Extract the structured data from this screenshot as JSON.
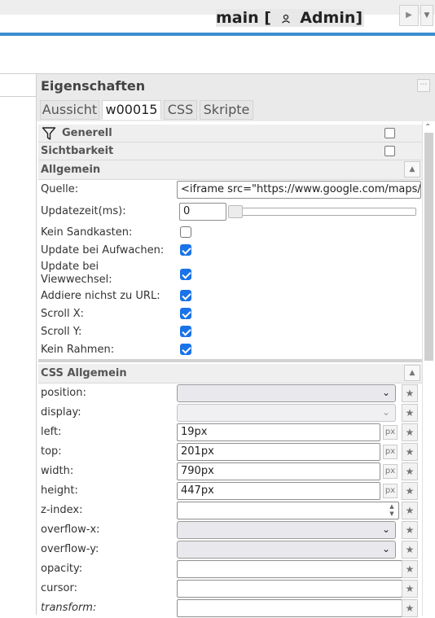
{
  "topbar": {
    "view_name": "main [",
    "user_name": "Admin]",
    "play_icon": "play-icon",
    "menu_icon": "dropdown-arrow-icon"
  },
  "panel": {
    "title": "Eigenschaften",
    "tabs": [
      "Aussicht",
      "w00015",
      "CSS",
      "Skripte"
    ],
    "active_tab": "w00015"
  },
  "groups": {
    "generell": "Generell",
    "sichtbarkeit": "Sichtbarkeit",
    "allgemein": "Allgemein",
    "css_allgemein": "CSS Allgemein"
  },
  "allgemein": {
    "quelle_label": "Quelle:",
    "quelle_value": "<iframe src=\"https://www.google.com/maps/",
    "update_label": "Updatezeit(ms):",
    "update_value": "0",
    "update_slider_level": 0,
    "kein_sandkasten": {
      "label": "Kein Sandkasten:",
      "checked": false
    },
    "update_aufwachen": {
      "label": "Update bei Aufwachen:",
      "checked": true
    },
    "update_viewwechsel": {
      "label": "Update bei Viewwechsel:",
      "checked": true
    },
    "addiere": {
      "label": "Addiere nichst zu URL:",
      "checked": true
    },
    "scroll_x": {
      "label": "Scroll X:",
      "checked": true
    },
    "scroll_y": {
      "label": "Scroll Y:",
      "checked": true
    },
    "kein_rahmen": {
      "label": "Kein Rahmen:",
      "checked": true
    }
  },
  "css": {
    "position_label": "position:",
    "display_label": "display:",
    "left_label": "left:",
    "left_value": "19px",
    "top_label": "top:",
    "top_value": "201px",
    "width_label": "width:",
    "width_value": "790px",
    "height_label": "height:",
    "height_value": "447px",
    "zindex_label": "z-index:",
    "overflowx_label": "overflow-x:",
    "overflowy_label": "overflow-y:",
    "opacity_label": "opacity:",
    "cursor_label": "cursor:",
    "transform_label": "transform:",
    "unit": "px"
  },
  "colors": {
    "accent_line": "#3b8ed0",
    "checkbox_checked": "#1a73e8"
  }
}
